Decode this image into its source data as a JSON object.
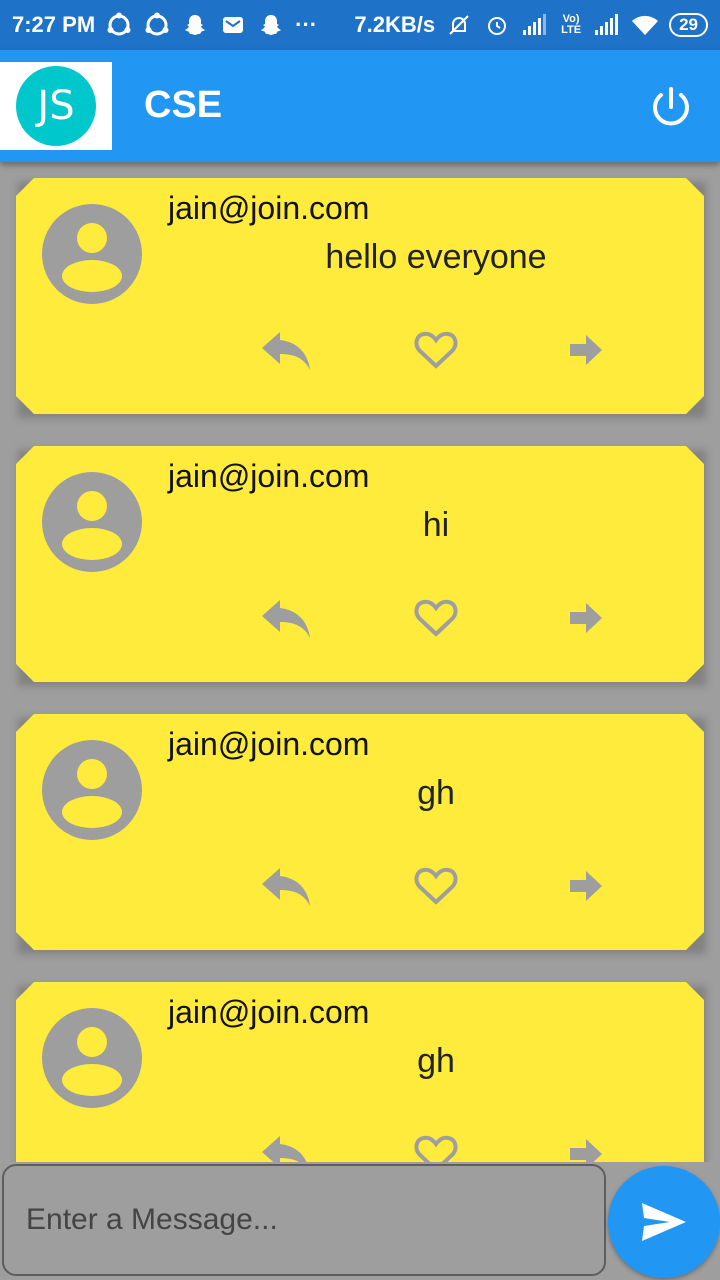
{
  "status_bar": {
    "time": "7:27 PM",
    "more": "···",
    "net_speed": "7.2KB/s",
    "volte": "Vo) LTE",
    "battery": "29"
  },
  "app_bar": {
    "logo_text": "JS",
    "title": "CSE"
  },
  "posts": [
    {
      "author": "jain@join.com",
      "message": "hello everyone"
    },
    {
      "author": "jain@join.com",
      "message": "hi"
    },
    {
      "author": "jain@join.com",
      "message": "gh"
    },
    {
      "author": "jain@join.com",
      "message": "gh"
    }
  ],
  "composer": {
    "placeholder": "Enter a Message..."
  },
  "colors": {
    "status_bar": "#1e73c8",
    "app_bar": "#2196f3",
    "card": "#ffeb3b",
    "background": "#9e9e9e",
    "icon_grey": "#9e9e9e",
    "logo": "#00c7cc"
  },
  "icons": [
    "sync-icon",
    "snapchat-icon",
    "mail-icon",
    "do-not-disturb-icon",
    "alarm-icon",
    "signal-icon",
    "wifi-icon",
    "battery-icon",
    "power-icon",
    "avatar-icon",
    "reply-icon",
    "heart-icon",
    "forward-icon",
    "send-icon"
  ]
}
